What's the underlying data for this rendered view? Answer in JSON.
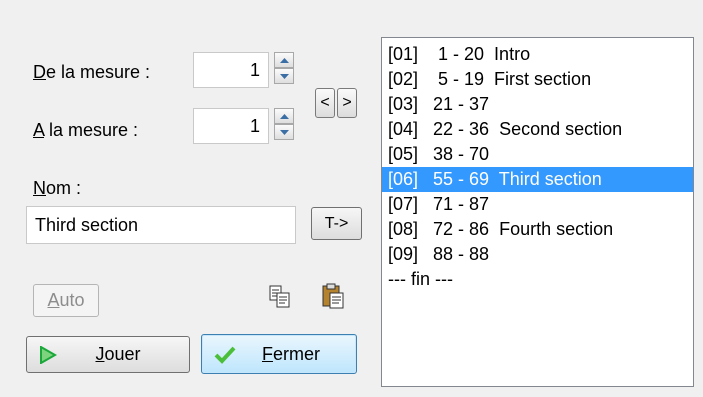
{
  "form": {
    "from_label_ul": "D",
    "from_label_rest": "e la mesure :",
    "from_value": "1",
    "to_label_ul": "A",
    "to_label_rest": " la mesure :",
    "to_value": "1",
    "name_label_ul": "N",
    "name_label_rest": "om :",
    "name_value": "Third section",
    "title_button": "T->",
    "prev_symbol": "<",
    "next_symbol": ">"
  },
  "buttons": {
    "auto_ul": "A",
    "auto_rest": "uto",
    "play_ul": "J",
    "play_rest": "ouer",
    "close_ul": "F",
    "close_rest": "ermer"
  },
  "icons": {
    "copy": "copy-icon",
    "paste": "paste-icon",
    "play": "play-icon",
    "check": "check-icon",
    "colors": {
      "play_green": "#1aa83a",
      "check_green": "#4cbf3a",
      "selection": "#3399ff"
    }
  },
  "list": {
    "items": [
      "[01]    1 - 20  Intro",
      "[02]    5 - 19  First section",
      "[03]   21 - 37",
      "[04]   22 - 36  Second section",
      "[05]   38 - 70",
      "[06]   55 - 69  Third section",
      "[07]   71 - 87",
      "[08]   72 - 86  Fourth section",
      "[09]   88 - 88",
      "--- fin ---"
    ],
    "selected_index": 5
  }
}
